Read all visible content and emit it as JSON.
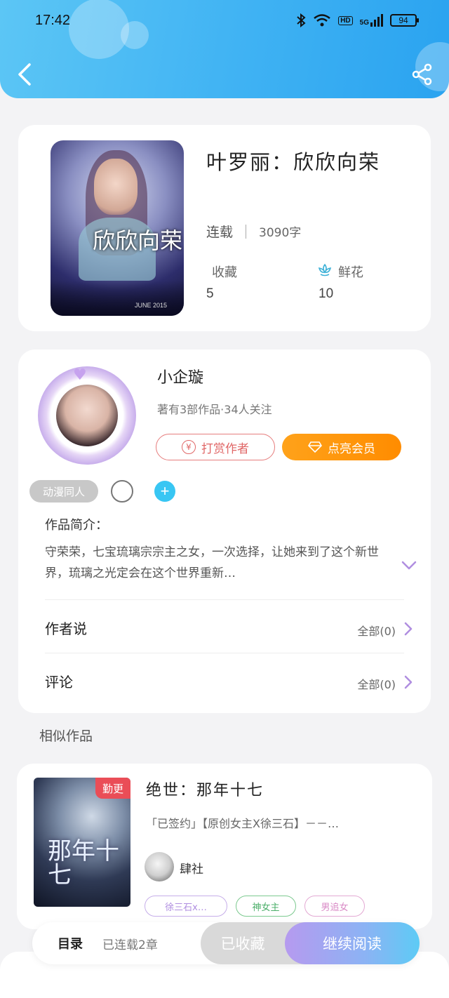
{
  "status_bar": {
    "time": "17:42",
    "network_badge": "HD",
    "signal_label": "5G",
    "battery": "94"
  },
  "book": {
    "title": "叶罗丽：欣欣向荣",
    "status": "连载",
    "word_count": "3090字",
    "favorites_label": "收藏",
    "favorites_count": "5",
    "flowers_label": "鲜花",
    "flowers_count": "10",
    "cover_text": "欣欣向荣",
    "cover_date": "JUNE 2015"
  },
  "author": {
    "name": "小企璇",
    "info": "著有3部作品·34人关注",
    "tip_button": "打赏作者",
    "tip_icon": "¥",
    "vip_button": "点亮会员",
    "tag": "动漫同人"
  },
  "intro": {
    "heading": "作品简介：",
    "text": "守荣荣，七宝琉璃宗宗主之女，一次选择，让她来到了这个新世界，琉璃之光定会在这个世界重新…"
  },
  "rows": {
    "author_says": "作者说",
    "author_says_count": "全部(0)",
    "comments": "评论",
    "comments_count": "全部(0)"
  },
  "similar": {
    "section_title": "相似作品",
    "book_title": "绝世：那年十七",
    "badge": "勤更",
    "description": "「已签约」【原创女主X徐三石】－－…",
    "author": "肆社",
    "cover_text": "那年十七",
    "chips": [
      "徐三石x…",
      "神女主",
      "男追女"
    ]
  },
  "bottom_bar": {
    "catalog": "目录",
    "chapters": "已连载2章",
    "collected": "已收藏",
    "continue": "继续阅读"
  },
  "colors": {
    "header_accent": "#3fb2f3",
    "vip_orange": "#ff8c00",
    "tip_red": "#e06767",
    "badge_red": "#ea4d57",
    "chip_purple": "#b08ee0",
    "chip_green": "#4caf6a",
    "chip_pink": "#d98ac6"
  }
}
